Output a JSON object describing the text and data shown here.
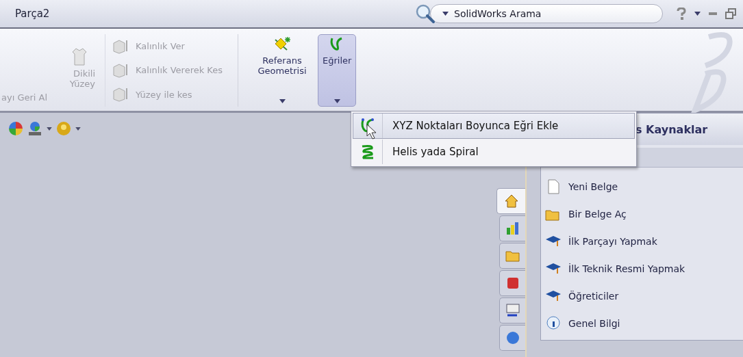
{
  "window": {
    "title": "Parça2"
  },
  "search": {
    "placeholder": "SolidWorks Arama"
  },
  "ribbon": {
    "cut_button": {
      "label": "ayı Geri Al",
      "disabled": true
    },
    "stitch_button": {
      "label": "Dikili Yüzey",
      "disabled": true
    },
    "small_buttons": [
      {
        "label": "Kalınlık Ver",
        "disabled": true
      },
      {
        "label": "Kalınlık Vererek Kes",
        "disabled": true
      },
      {
        "label": "Yüzey ile kes",
        "disabled": true
      }
    ],
    "large_buttons": [
      {
        "label": "Referans Geometrisi",
        "selected": false
      },
      {
        "label": "Eğriler",
        "selected": true
      }
    ]
  },
  "menu": {
    "items": [
      {
        "label": "XYZ Noktaları Boyunca Eğri Ekle",
        "selected": true
      },
      {
        "label": "Helis yada Spiral",
        "selected": false
      }
    ]
  },
  "task_pane": {
    "title": "s Kaynaklar",
    "tabs": [
      {
        "selected": true
      },
      {
        "selected": false
      },
      {
        "selected": false
      },
      {
        "selected": false
      },
      {
        "selected": false
      },
      {
        "selected": false
      }
    ],
    "items": [
      {
        "label": "Yeni Belge"
      },
      {
        "label": "Bir Belge Aç"
      },
      {
        "label": "İlk Parçayı Yapmak"
      },
      {
        "label": "İlk Teknik Resmi Yapmak"
      },
      {
        "label": "Öğreticiler"
      },
      {
        "label": "Genel Bilgi"
      }
    ]
  }
}
